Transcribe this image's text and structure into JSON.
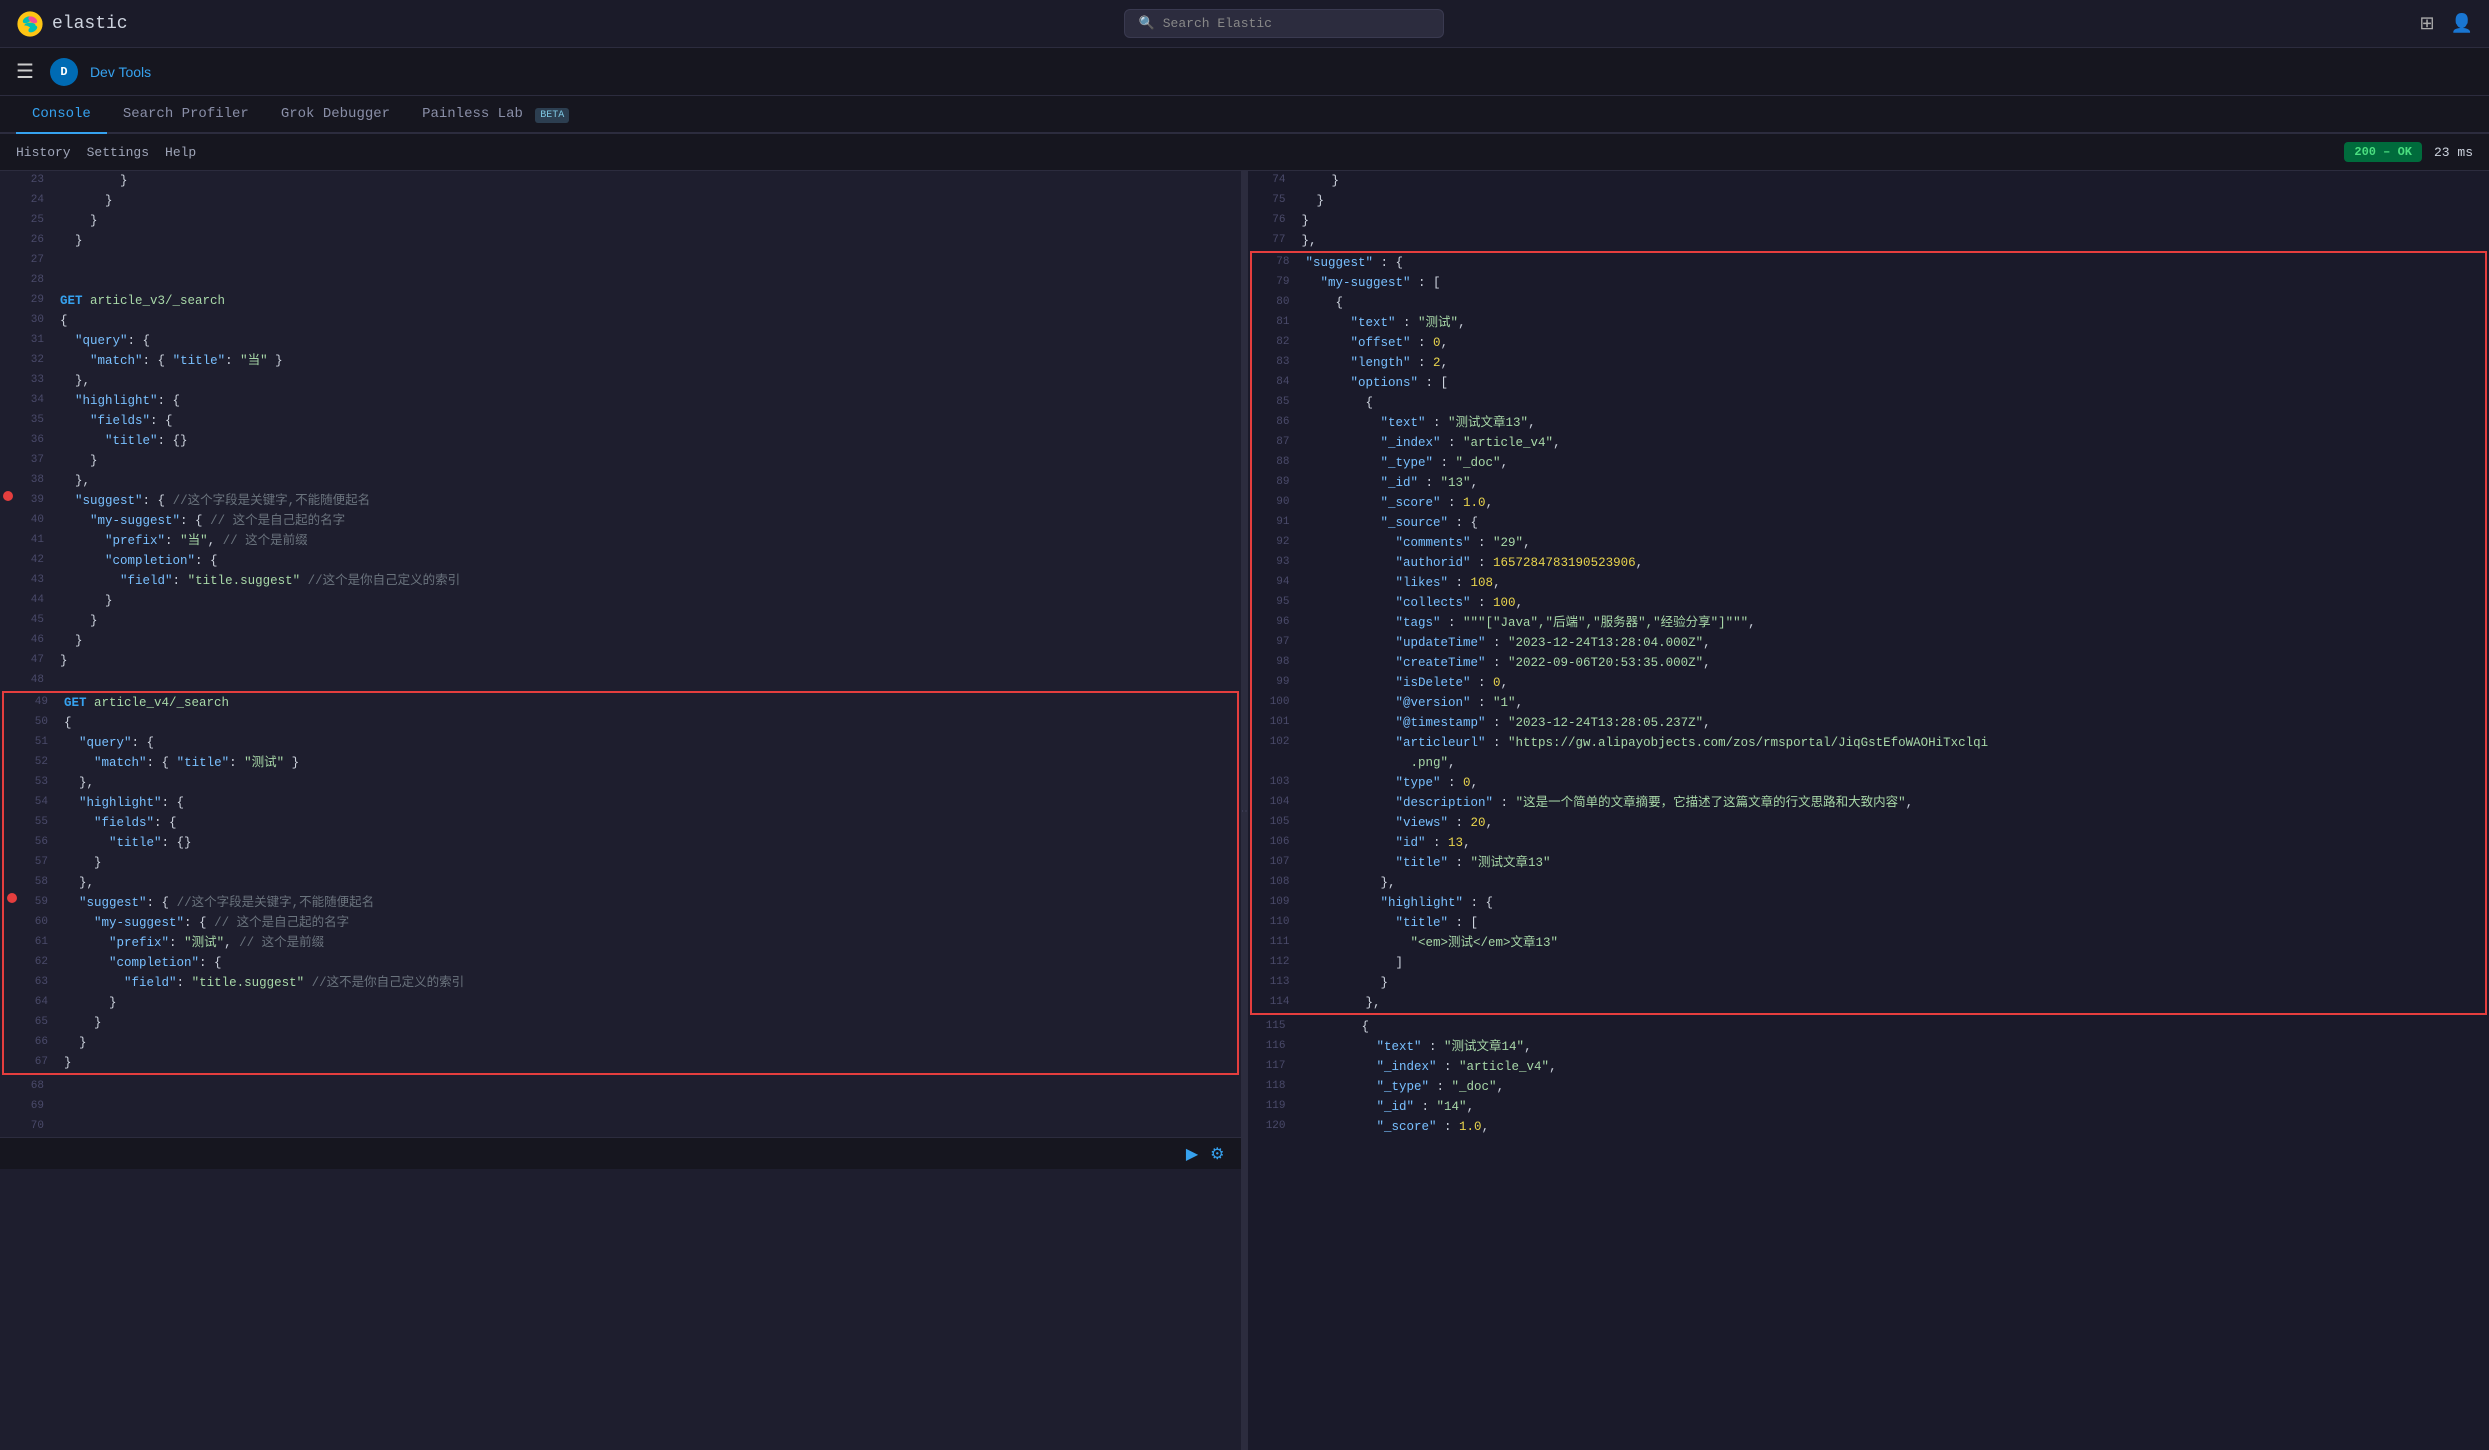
{
  "topBar": {
    "logoText": "elastic",
    "searchPlaceholder": "Search Elastic",
    "rightIcons": [
      "grid-icon",
      "user-icon"
    ]
  },
  "secondaryNav": {
    "devToolsLabel": "Dev Tools",
    "avatarLetter": "D"
  },
  "tabs": [
    {
      "label": "Console",
      "active": true
    },
    {
      "label": "Search Profiler",
      "active": false
    },
    {
      "label": "Grok Debugger",
      "active": false
    },
    {
      "label": "Painless Lab",
      "active": false,
      "badge": "BETA"
    }
  ],
  "subNav": {
    "items": [
      "History",
      "Settings",
      "Help"
    ],
    "statusCode": "200 – OK",
    "responseTime": "23 ms"
  },
  "leftEditor": {
    "lines": [
      {
        "num": 23,
        "indent": "        ",
        "content": "}"
      },
      {
        "num": 24,
        "indent": "      ",
        "content": "}"
      },
      {
        "num": 25,
        "indent": "    ",
        "content": "}"
      },
      {
        "num": 26,
        "indent": "  ",
        "content": "}"
      },
      {
        "num": 27,
        "indent": "",
        "content": ""
      },
      {
        "num": 28,
        "indent": "",
        "content": ""
      },
      {
        "num": 29,
        "indent": "",
        "content": "GET article_v3/_search",
        "type": "method"
      },
      {
        "num": 30,
        "indent": "",
        "content": "{"
      },
      {
        "num": 31,
        "indent": "  ",
        "content": "\"query\": {"
      },
      {
        "num": 32,
        "indent": "    ",
        "content": "\"match\": { \"title\": \"当\" }"
      },
      {
        "num": 33,
        "indent": "  ",
        "content": "},"
      },
      {
        "num": 34,
        "indent": "  ",
        "content": "\"highlight\": {"
      },
      {
        "num": 35,
        "indent": "    ",
        "content": "\"fields\": {"
      },
      {
        "num": 36,
        "indent": "      ",
        "content": "\"title\": {}"
      },
      {
        "num": 37,
        "indent": "    ",
        "content": "}"
      },
      {
        "num": 38,
        "indent": "  ",
        "content": "},"
      },
      {
        "num": 39,
        "indent": "  ",
        "content": "\"suggest\": { //这个字段是关键字,不能随便起名",
        "error": true
      },
      {
        "num": 40,
        "indent": "    ",
        "content": "\"my-suggest\": { // 这个是自己起的名字"
      },
      {
        "num": 41,
        "indent": "      ",
        "content": "\"prefix\": \"当\", // 这个是前缀"
      },
      {
        "num": 42,
        "indent": "      ",
        "content": "\"completion\": {"
      },
      {
        "num": 43,
        "indent": "        ",
        "content": "\"field\": \"title.suggest\" //这个是你自己定义的索引"
      },
      {
        "num": 44,
        "indent": "      ",
        "content": "}"
      },
      {
        "num": 45,
        "indent": "    ",
        "content": "}"
      },
      {
        "num": 46,
        "indent": "  ",
        "content": "}"
      },
      {
        "num": 47,
        "indent": "",
        "content": "}"
      },
      {
        "num": 48,
        "indent": "",
        "content": ""
      },
      {
        "num": 49,
        "indent": "",
        "content": "GET article_v4/_search",
        "type": "method",
        "blockStart": true
      },
      {
        "num": 50,
        "indent": "",
        "content": "{"
      },
      {
        "num": 51,
        "indent": "  ",
        "content": "\"query\": {"
      },
      {
        "num": 52,
        "indent": "    ",
        "content": "\"match\": { \"title\": \"测试\" }"
      },
      {
        "num": 53,
        "indent": "  ",
        "content": "},"
      },
      {
        "num": 54,
        "indent": "  ",
        "content": "\"highlight\": {"
      },
      {
        "num": 55,
        "indent": "    ",
        "content": "\"fields\": {"
      },
      {
        "num": 56,
        "indent": "      ",
        "content": "\"title\": {}"
      },
      {
        "num": 57,
        "indent": "    ",
        "content": "}"
      },
      {
        "num": 58,
        "indent": "  ",
        "content": "},"
      },
      {
        "num": 59,
        "indent": "  ",
        "content": "\"suggest\": { //这个字段是关键字,不能随便起名",
        "error": true
      },
      {
        "num": 60,
        "indent": "    ",
        "content": "\"my-suggest\": { // 这个是自己起的名字"
      },
      {
        "num": 61,
        "indent": "      ",
        "content": "\"prefix\": \"测试\", // 这个是前缀"
      },
      {
        "num": 62,
        "indent": "      ",
        "content": "\"completion\": {"
      },
      {
        "num": 63,
        "indent": "        ",
        "content": "\"field\": \"title.suggest\" //这不是你自己定义的索引"
      },
      {
        "num": 64,
        "indent": "      ",
        "content": "}"
      },
      {
        "num": 65,
        "indent": "    ",
        "content": "}"
      },
      {
        "num": 66,
        "indent": "  ",
        "content": "}"
      },
      {
        "num": 67,
        "indent": "",
        "content": "}",
        "blockEnd": true
      },
      {
        "num": 68,
        "indent": "",
        "content": ""
      },
      {
        "num": 69,
        "indent": "",
        "content": ""
      },
      {
        "num": 70,
        "indent": "",
        "content": ""
      }
    ]
  },
  "rightEditor": {
    "lines": [
      {
        "num": 74,
        "content": "    }"
      },
      {
        "num": 75,
        "content": "  }"
      },
      {
        "num": 76,
        "content": "}"
      },
      {
        "num": 77,
        "content": "},"
      },
      {
        "num": 78,
        "content": "\"suggest\" : {",
        "blockStart": true
      },
      {
        "num": 79,
        "content": "  \"my-suggest\" : ["
      },
      {
        "num": 80,
        "content": "    {"
      },
      {
        "num": 81,
        "content": "      \"text\" : \"测试\","
      },
      {
        "num": 82,
        "content": "      \"offset\" : 0,"
      },
      {
        "num": 83,
        "content": "      \"length\" : 2,"
      },
      {
        "num": 84,
        "content": "      \"options\" : ["
      },
      {
        "num": 85,
        "content": "        {"
      },
      {
        "num": 86,
        "content": "          \"text\" : \"测试文章13\","
      },
      {
        "num": 87,
        "content": "          \"_index\" : \"article_v4\","
      },
      {
        "num": 88,
        "content": "          \"_type\" : \"_doc\","
      },
      {
        "num": 89,
        "content": "          \"_id\" : \"13\","
      },
      {
        "num": 90,
        "content": "          \"_score\" : 1.0,"
      },
      {
        "num": 91,
        "content": "          \"_source\" : {"
      },
      {
        "num": 92,
        "content": "            \"comments\" : \"29\","
      },
      {
        "num": 93,
        "content": "            \"authorid\" : 1657284783190523906,"
      },
      {
        "num": 94,
        "content": "            \"likes\" : 108,"
      },
      {
        "num": 95,
        "content": "            \"collects\" : 100,"
      },
      {
        "num": 96,
        "content": "            \"tags\" : \"\"\"[\"Java\",\"后端\",\"服务器\",\"经验分享\"]\"\"\","
      },
      {
        "num": 97,
        "content": "            \"updateTime\" : \"2023-12-24T13:28:04.000Z\","
      },
      {
        "num": 98,
        "content": "            \"createTime\" : \"2022-09-06T20:53:35.000Z\","
      },
      {
        "num": 99,
        "content": "            \"isDelete\" : 0,"
      },
      {
        "num": 100,
        "content": "            \"@version\" : \"1\","
      },
      {
        "num": 101,
        "content": "            \"@timestamp\" : \"2023-12-24T13:28:05.237Z\","
      },
      {
        "num": 102,
        "content": "            \"articleurl\" : \"https://gw.alipayobjects.com/zos/rmsportal/JiqGstEfoWAOHiTxclqi.png\","
      },
      {
        "num": 103,
        "content": "            \"type\" : 0,"
      },
      {
        "num": 104,
        "content": "            \"description\" : \"这是一个简单的文章摘要，它描述了这篇文章的行文思路和大致内容\","
      },
      {
        "num": 105,
        "content": "            \"views\" : 20,"
      },
      {
        "num": 106,
        "content": "            \"id\" : 13,"
      },
      {
        "num": 107,
        "content": "            \"title\" : \"测试文章13\""
      },
      {
        "num": 108,
        "content": "          },"
      },
      {
        "num": 109,
        "content": "          \"highlight\" : {"
      },
      {
        "num": 110,
        "content": "            \"title\" : ["
      },
      {
        "num": 111,
        "content": "              \"<em>测试</em>文章13\""
      },
      {
        "num": 112,
        "content": "            ]"
      },
      {
        "num": 113,
        "content": "          }"
      },
      {
        "num": 114,
        "content": "        },",
        "blockEnd": true
      },
      {
        "num": 115,
        "content": "        {"
      },
      {
        "num": 116,
        "content": "          \"text\" : \"测试文章14\","
      },
      {
        "num": 117,
        "content": "          \"_index\" : \"article_v4\","
      },
      {
        "num": 118,
        "content": "          \"_type\" : \"_doc\","
      },
      {
        "num": 119,
        "content": "          \"_id\" : \"14\","
      },
      {
        "num": 120,
        "content": "          \"_score\" : 1.0,"
      }
    ]
  },
  "bottomToolbar": {
    "playIcon": "▶",
    "settingsIcon": "⚙"
  }
}
